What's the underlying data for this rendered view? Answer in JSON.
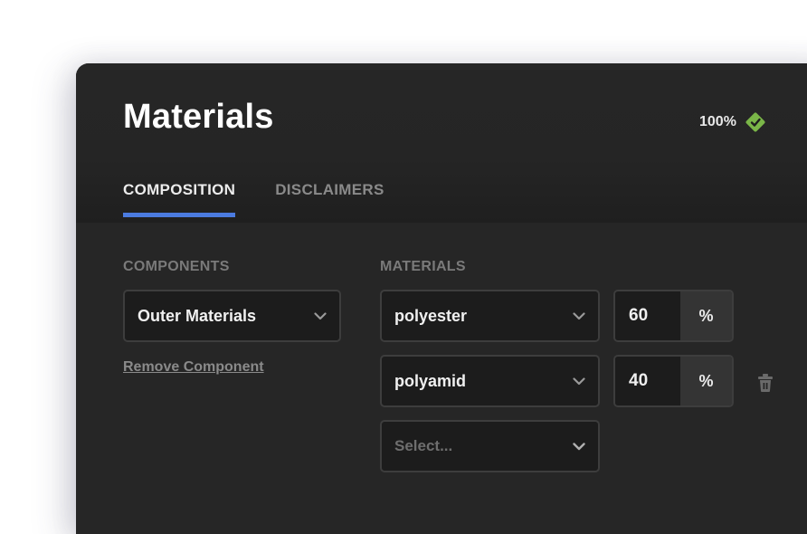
{
  "header": {
    "title": "Materials",
    "progress_text": "100%",
    "progress_icon": "check-diamond-icon",
    "accent_color": "#7ab648"
  },
  "tabs": [
    {
      "label": "COMPOSITION",
      "active": true
    },
    {
      "label": "DISCLAIMERS",
      "active": false
    }
  ],
  "tab_indicator_color": "#4b7be0",
  "components": {
    "label": "COMPONENTS",
    "selected": "Outer Materials",
    "remove_link": "Remove Component"
  },
  "materials": {
    "label": "MATERIALS",
    "rows": [
      {
        "material": "polyester",
        "percent": "60",
        "unit": "%"
      },
      {
        "material": "polyamid",
        "percent": "40",
        "unit": "%",
        "delete_icon": "trash-icon"
      }
    ],
    "new_row_placeholder": "Select..."
  }
}
